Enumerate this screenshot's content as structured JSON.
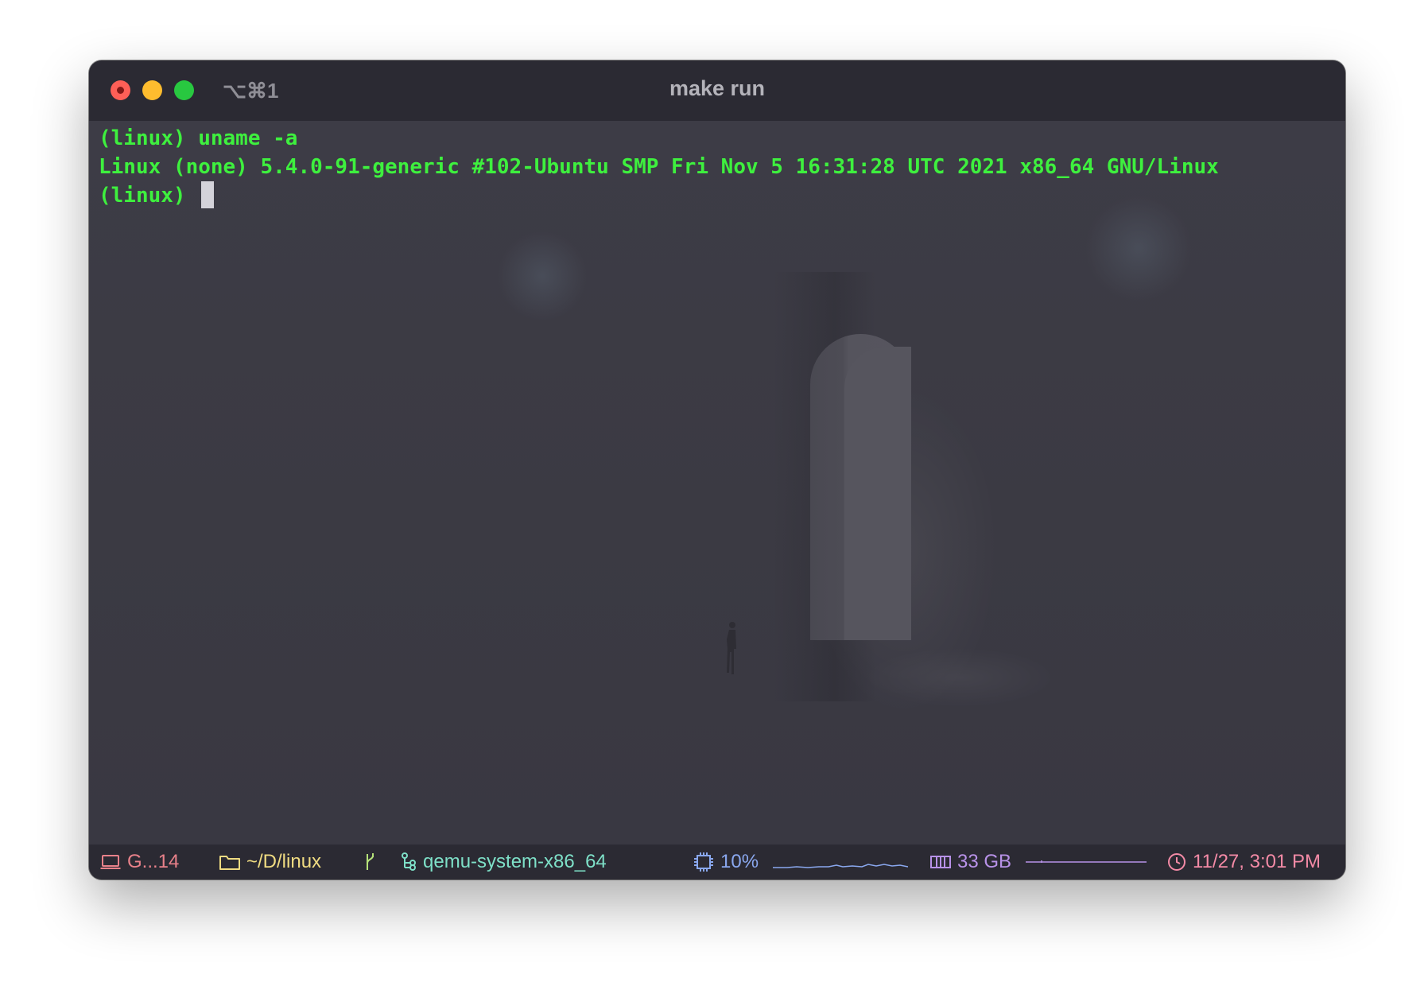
{
  "window": {
    "shortcut": "⌥⌘1",
    "title": "make run"
  },
  "terminal": {
    "lines": [
      "(linux) uname -a",
      "Linux (none) 5.4.0-91-generic #102-Ubuntu SMP Fri Nov 5 16:31:28 UTC 2021 x86_64 GNU/Linux",
      "(linux) "
    ]
  },
  "status": {
    "host": "G...14",
    "directory": "~/D/linux",
    "process": "qemu-system-x86_64",
    "cpu": "10%",
    "memory": "33 GB",
    "clock": "11/27, 3:01 PM"
  },
  "colors": {
    "host": "#e8818a",
    "directory": "#f0dc82",
    "git": "#b6e27a",
    "process": "#7ee0c8",
    "cpu": "#8aa8ef",
    "memory": "#b892e8",
    "clock": "#f38aa6",
    "terminal_text": "#3ef03e"
  }
}
